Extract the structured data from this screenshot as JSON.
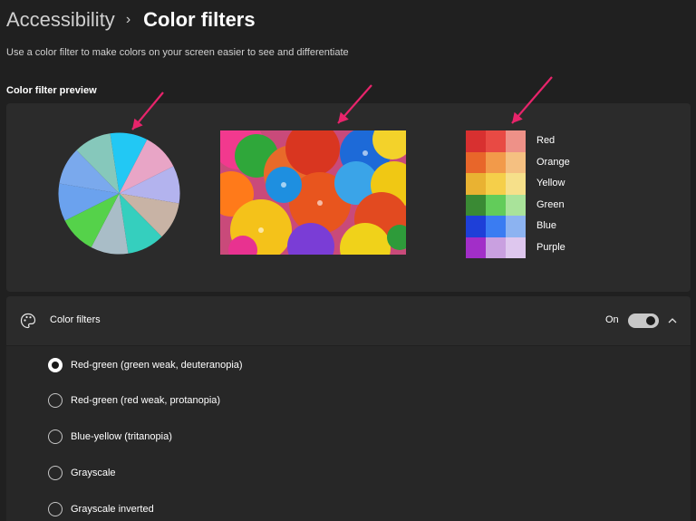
{
  "header": {
    "parent": "Accessibility",
    "separator": "›",
    "current": "Color filters"
  },
  "description": "Use a color filter to make colors on your screen easier to see and differentiate",
  "preview": {
    "section_label": "Color filter preview",
    "pie_colors": [
      "#22c8f4",
      "#e8a5c6",
      "#b3b3ee",
      "#c8b3a5",
      "#35cfbe",
      "#a9bdc7",
      "#55d24a",
      "#6ba2ee",
      "#7aa9ed",
      "#86c8bb"
    ],
    "swatches": [
      {
        "label": "Red",
        "colors": [
          "#d83030",
          "#e84a44",
          "#ee9188"
        ]
      },
      {
        "label": "Orange",
        "colors": [
          "#e8662a",
          "#f29a4a",
          "#f5c081"
        ]
      },
      {
        "label": "Yellow",
        "colors": [
          "#e9b232",
          "#f5cf4a",
          "#f6e08a"
        ]
      },
      {
        "label": "Green",
        "colors": [
          "#3a8a34",
          "#62cc5a",
          "#a9e39a"
        ]
      },
      {
        "label": "Blue",
        "colors": [
          "#1e3fd8",
          "#3a7cf2",
          "#8cb3f1"
        ]
      },
      {
        "label": "Purple",
        "colors": [
          "#a22ec8",
          "#c9a0e0",
          "#dec7ee"
        ]
      }
    ],
    "annotation_color": "#e8246b"
  },
  "filters": {
    "icon": "palette-icon",
    "title": "Color filters",
    "toggle_label": "On",
    "toggle_on": true,
    "options": [
      {
        "label": "Red-green (green weak, deuteranopia)",
        "selected": true
      },
      {
        "label": "Red-green (red weak, protanopia)",
        "selected": false
      },
      {
        "label": "Blue-yellow (tritanopia)",
        "selected": false
      },
      {
        "label": "Grayscale",
        "selected": false
      },
      {
        "label": "Grayscale inverted",
        "selected": false
      }
    ]
  }
}
